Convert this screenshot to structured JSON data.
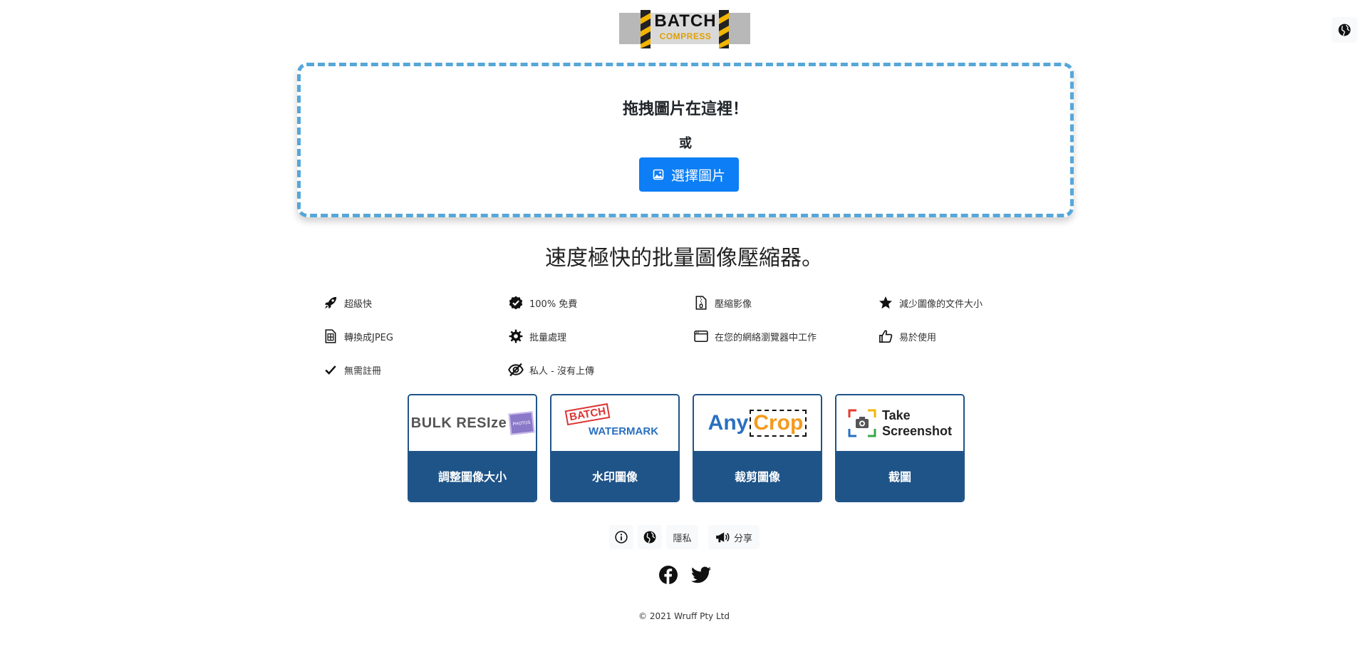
{
  "header": {
    "logo_text_line1": "BATCH",
    "logo_text_line2": "COMPRESS",
    "language_icon": "globe-icon"
  },
  "dropzone": {
    "title": "拖拽圖片在這裡！",
    "or_text": "或",
    "button_label": "選擇圖片",
    "border_color": "#56a7d9",
    "button_color": "#0d7ef5"
  },
  "tagline": "速度極快的批量圖像壓縮器。",
  "features": [
    {
      "label": "超級快",
      "icon": "rocket-icon"
    },
    {
      "label": "100% 免費",
      "icon": "check-badge-icon"
    },
    {
      "label": "壓縮影像",
      "icon": "file-zip-icon"
    },
    {
      "label": "減少圖像的文件大小",
      "icon": "star-icon"
    },
    {
      "label": "轉換成JPEG",
      "icon": "file-convert-icon"
    },
    {
      "label": "批量處理",
      "icon": "gear-icon"
    },
    {
      "label": "在您的網絡瀏覽器中工作",
      "icon": "browser-icon"
    },
    {
      "label": "易於使用",
      "icon": "thumbs-up-icon"
    },
    {
      "label": "無需註冊",
      "icon": "check-icon"
    },
    {
      "label": "私人 - 沒有上傳",
      "icon": "eye-slash-icon"
    }
  ],
  "cards": [
    {
      "logo": "BULK RESIze",
      "logo_badge": "PHOTOS",
      "label": "調整圖像大小"
    },
    {
      "logo": "BATCH",
      "logo2": "WATERMARK",
      "label": "水印圖像"
    },
    {
      "logo": "Any",
      "logo2": "Crop",
      "label": "裁剪圖像"
    },
    {
      "logo": "Take",
      "logo2": "Screenshot",
      "label": "截圖"
    }
  ],
  "footer": {
    "privacy_label": "隱私",
    "share_label": "分享",
    "copyright": "© 2021 Wruff Pty Ltd"
  },
  "colors": {
    "card_blue": "#1f5489",
    "primary": "#0d7ef5"
  }
}
